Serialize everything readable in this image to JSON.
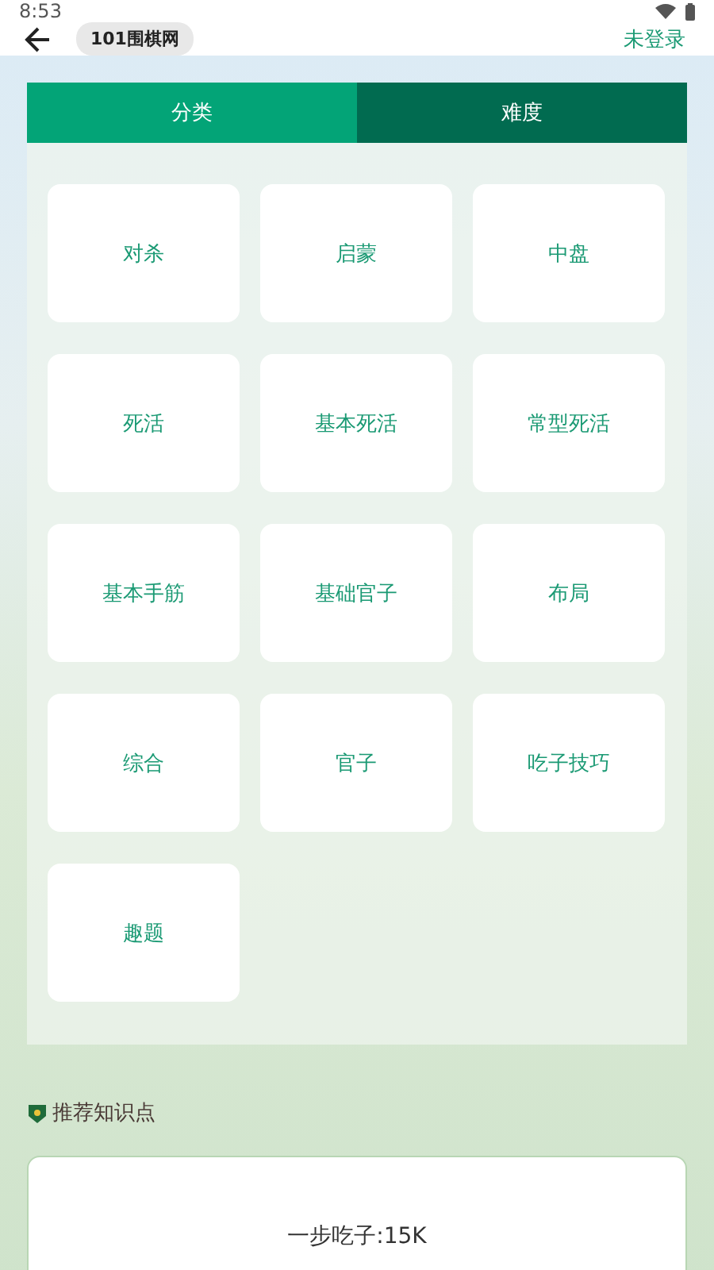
{
  "status_bar": {
    "time": "8:53"
  },
  "header": {
    "site": "101围棋网",
    "login": "未登录"
  },
  "tabs": [
    {
      "label": "分类",
      "selected": true
    },
    {
      "label": "难度",
      "selected": false
    }
  ],
  "categories": [
    "对杀",
    "启蒙",
    "中盘",
    "死活",
    "基本死活",
    "常型死活",
    "基本手筋",
    "基础官子",
    "布局",
    "综合",
    "官子",
    "吃子技巧",
    "趣题"
  ],
  "recommend": {
    "title": "推荐知识点",
    "items": [
      "一步吃子:15K"
    ]
  }
}
